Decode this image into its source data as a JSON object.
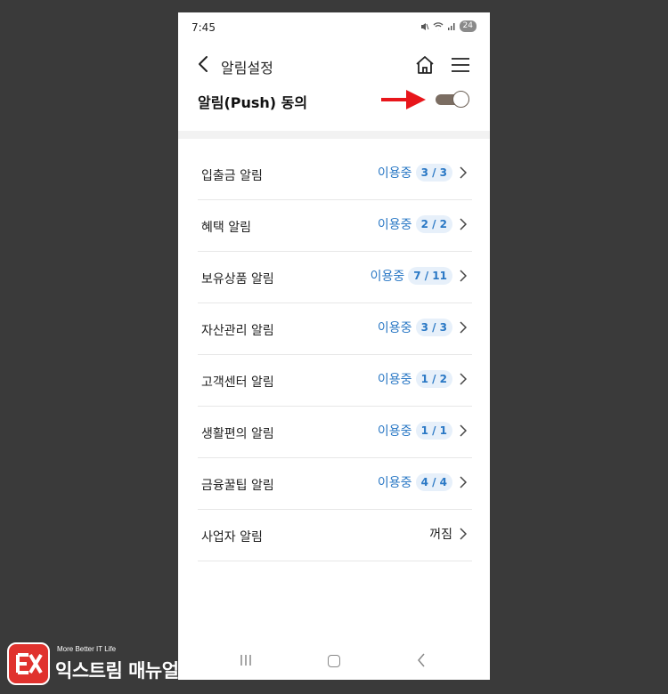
{
  "status_bar": {
    "time": "7:45",
    "battery": "24"
  },
  "header": {
    "title": "알림설정"
  },
  "push": {
    "label": "알림(Push) 동의",
    "enabled": true
  },
  "colors": {
    "accent": "#2a78c5",
    "toggle_on": "#7b6d62",
    "arrow": "#e8161b",
    "background": "#3a3a3a"
  },
  "items": [
    {
      "label": "입출금 알림",
      "status": "이용중",
      "count": "3 / 3"
    },
    {
      "label": "혜택 알림",
      "status": "이용중",
      "count": "2 / 2"
    },
    {
      "label": "보유상품 알림",
      "status": "이용중",
      "count": "7 / 11"
    },
    {
      "label": "자산관리 알림",
      "status": "이용중",
      "count": "3 / 3"
    },
    {
      "label": "고객센터 알림",
      "status": "이용중",
      "count": "1 / 2"
    },
    {
      "label": "생활편의 알림",
      "status": "이용중",
      "count": "1 / 1"
    },
    {
      "label": "금융꿀팁 알림",
      "status": "이용중",
      "count": "4 / 4"
    },
    {
      "label": "사업자 알림",
      "status": "꺼짐"
    }
  ],
  "watermark": {
    "tagline": "More Better IT Life",
    "name": "익스트림 매뉴얼"
  }
}
